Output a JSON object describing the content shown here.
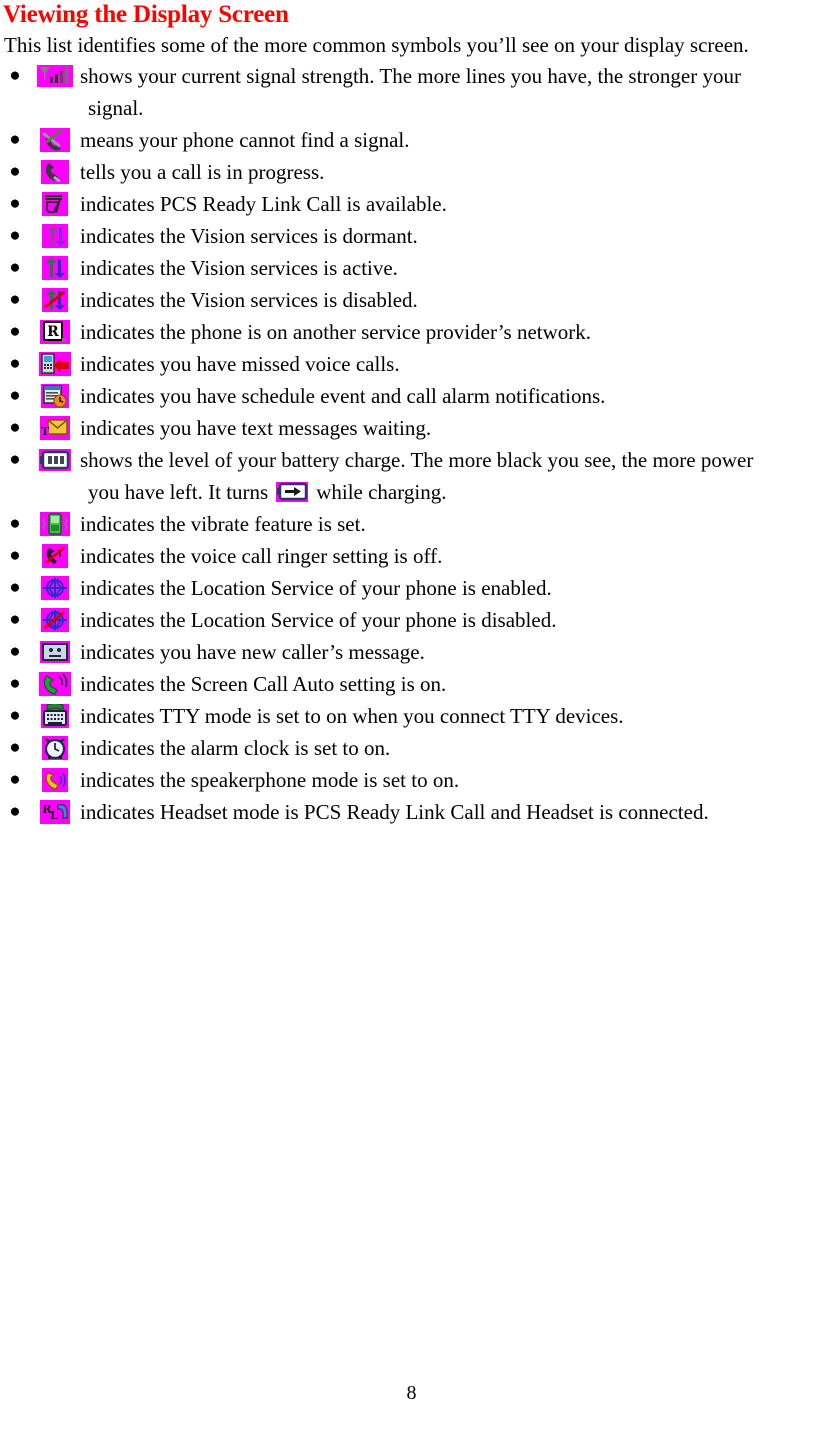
{
  "document": {
    "heading": "Viewing the Display Screen",
    "heading_color": "#ff0000",
    "intro": "This list identifies some of the more common symbols you’ll see on your display screen.",
    "page_number": "8",
    "background_color": "#ffffff",
    "text_color": "#000000",
    "icon_background_color": "#ff00ff"
  },
  "list": {
    "bullet_glyph": "●",
    "items": [
      {
        "icon": "signal-strength-icon",
        "text": "shows your current signal strength. The more lines you have, the stronger your",
        "continuation": "signal."
      },
      {
        "icon": "no-signal-icon",
        "text": "means your phone cannot find a signal."
      },
      {
        "icon": "call-in-progress-icon",
        "text": "tells you a call is in progress."
      },
      {
        "icon": "ready-link-available-icon",
        "text": "indicates PCS Ready Link Call is available."
      },
      {
        "icon": "vision-dormant-icon",
        "text": "indicates the Vision services is dormant."
      },
      {
        "icon": "vision-active-icon",
        "text": "indicates the Vision services is active."
      },
      {
        "icon": "vision-disabled-icon",
        "text": "indicates the Vision services is disabled."
      },
      {
        "icon": "roaming-icon",
        "text": "indicates the phone is on another service provider’s network."
      },
      {
        "icon": "missed-voice-calls-icon",
        "text": "indicates you have missed voice calls."
      },
      {
        "icon": "schedule-alarm-icon",
        "text": "indicates you have schedule event and call alarm notifications."
      },
      {
        "icon": "text-message-icon",
        "text": "indicates you have text messages waiting."
      },
      {
        "icon": "battery-icon",
        "text": "shows the level of your battery charge. The more black you see, the more power",
        "wrap_before": "you have left. It turns",
        "wrap_icon": "battery-charging-icon",
        "wrap_after": "while charging."
      },
      {
        "icon": "vibrate-icon",
        "text": "indicates the vibrate feature is set."
      },
      {
        "icon": "ringer-off-icon",
        "text": "indicates the voice call ringer setting is off."
      },
      {
        "icon": "location-enabled-icon",
        "text": "indicates the Location Service of your phone is enabled."
      },
      {
        "icon": "location-disabled-icon",
        "text": "indicates the Location Service of your phone is disabled."
      },
      {
        "icon": "caller-message-icon",
        "text": "indicates you have new caller’s message."
      },
      {
        "icon": "screen-call-auto-icon",
        "text": "indicates the Screen Call Auto setting is on."
      },
      {
        "icon": "tty-mode-icon",
        "text": "indicates TTY mode is set to on when you connect TTY devices."
      },
      {
        "icon": "alarm-clock-icon",
        "text": "indicates the alarm clock is set to on."
      },
      {
        "icon": "speakerphone-icon",
        "text": "indicates the speakerphone mode is set to on."
      },
      {
        "icon": "headset-ready-link-icon",
        "text": "indicates Headset mode is PCS Ready Link Call and Headset is connected."
      }
    ]
  }
}
